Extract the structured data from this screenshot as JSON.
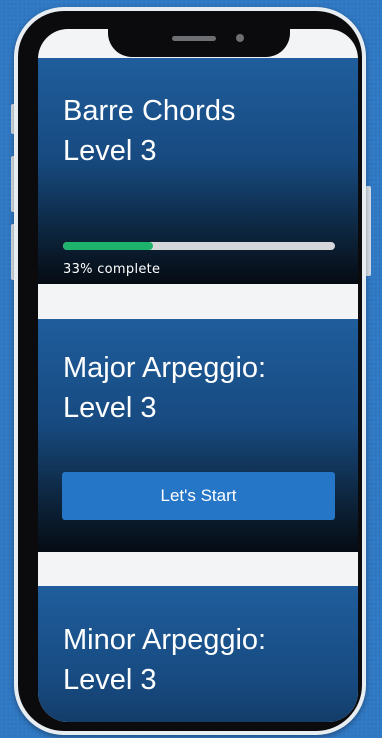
{
  "colors": {
    "background": "#2f78c4",
    "card_top": "#1f5d9c",
    "card_bottom": "#050b13",
    "progress_fill": "#1db36c",
    "progress_track": "#d4d6d9",
    "button": "#2576c6"
  },
  "lessons": [
    {
      "title_line1": "Barre Chords",
      "title_line2": "Level 3",
      "progress": 0.33,
      "progress_label": "33% complete"
    },
    {
      "title_line1": "Major Arpeggio:",
      "title_line2": "Level 3",
      "button_label": "Let's Start"
    },
    {
      "title_line1": "Minor Arpeggio:",
      "title_line2": "Level 3"
    }
  ]
}
